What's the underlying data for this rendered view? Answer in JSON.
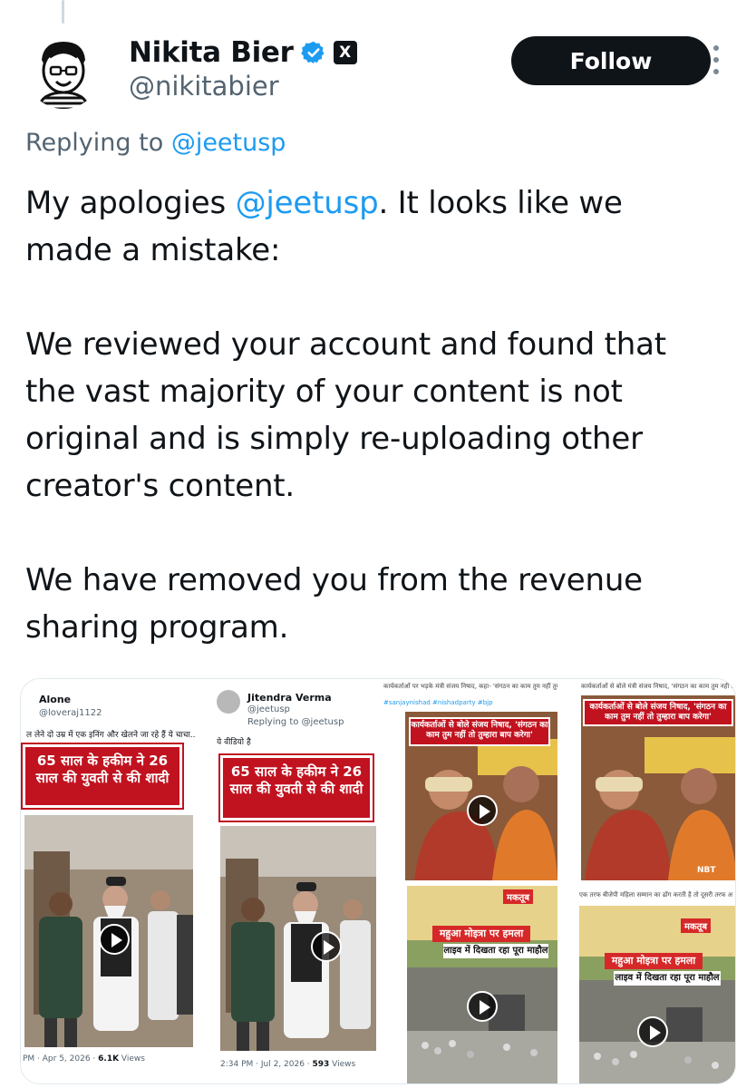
{
  "author": {
    "display_name": "Nikita Bier",
    "handle": "@nikitabier",
    "x_badge": "X",
    "follow_label": "Follow"
  },
  "reply": {
    "prefix": "Replying to ",
    "to": "@jeetusp"
  },
  "tweet": {
    "line1_before": "My apologies ",
    "line1_mention": "@jeetusp",
    "line1_after": ". It looks like we",
    "line2": "made a mistake:",
    "para2": [
      "We reviewed your account and found that",
      "the vast majority of your content is not",
      "original and is simply re-uploading other",
      "creator's content."
    ],
    "para3": [
      "We have removed you from the revenue",
      "sharing program."
    ]
  },
  "media": {
    "panel1": {
      "name": "Alone",
      "handle": "@loveraj1122",
      "text": "ल लेने दो उम्र में एक इनिंग और खेलने जा रहे हैं ये चाचा..",
      "headline": "65 साल के हकीम ने 26 साल की युवती से की शादी",
      "meta_time": "PM · Apr 5, 2026 · ",
      "meta_views_count": "6.1K",
      "meta_views_label": " Views"
    },
    "panel2": {
      "name": "Jitendra Verma",
      "handle": "@jeetusp",
      "replying": "Replying to @jeetusp",
      "text": "ये वीडियो है",
      "headline": "65 साल के हकीम ने 26 साल की युवती से की शादी",
      "meta_time": "2:34 PM · Jul 2, 2026 · ",
      "meta_views_count": "593",
      "meta_views_label": " Views"
    },
    "panel3": {
      "caption": "कार्यकर्ताओं पर भड़के मंत्री संजय निषाद, कहा- 'संगठन का काम तुम नहीं तुम्हारा बाप करेगा'",
      "hashtags": "#sanjaynishad #nishadparty #bjp",
      "banner": "कार्यकर्ताओं से बोले संजय निषाद, 'संगठन का काम तुम नहीं तो तुम्हारा बाप करेगा'"
    },
    "panel4": {
      "caption": "कार्यकर्ताओं से बोले मंत्री संजय निषाद, 'संगठन का काम तुम नहीं तो तुम्हारा बाप करेगा'",
      "banner": "कार्यकर्ताओं से बोले संजय निषाद, 'संगठन का काम तुम नहीं तो तुम्हारा बाप करेगा'",
      "tag": "NBT"
    },
    "panel5": {
      "brand": "मकतूब",
      "banner1": "महुआ मोइत्रा पर हमला",
      "banner2": "लाइव में दिखता रहा पूरा माहौल"
    },
    "panel6": {
      "caption": "एक तरफ बीजेपी महिला सम्मान का ढोंग करती है तो दूसरी तरफ अ",
      "brand": "मकतूब",
      "banner1": "महुआ मोइत्रा पर हमला",
      "banner2": "लाइव में दिखता रहा पूरा माहौल"
    }
  },
  "colors": {
    "link": "#1d9bf0",
    "verified": "#1d9bf0",
    "follow_bg": "#0f1419",
    "headline_red": "#c1121f"
  }
}
